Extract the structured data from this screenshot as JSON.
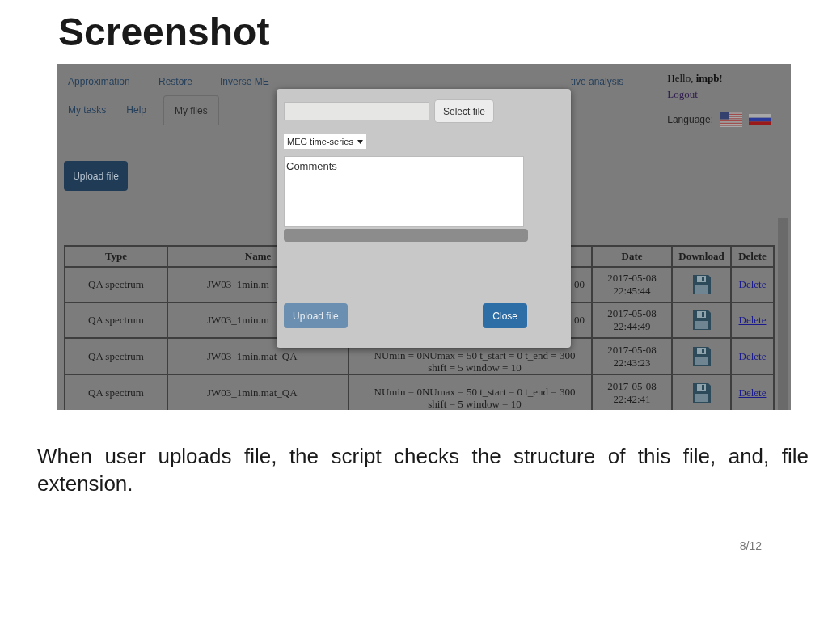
{
  "slide": {
    "title": "Screenshot",
    "caption": "When user uploads file, the script checks the structure of this file, and, file extension.",
    "page_number": "8/12"
  },
  "screen": {
    "nav_tabs": [
      {
        "label": "Approximation",
        "selected": false
      },
      {
        "label": "Restore",
        "selected": false
      },
      {
        "label": "Inverse ME",
        "selected": false
      },
      {
        "label": "tive analysis",
        "selected": false
      }
    ],
    "sub_tabs": [
      {
        "label": "My tasks",
        "selected": false
      },
      {
        "label": "Help",
        "selected": false
      },
      {
        "label": "My files",
        "selected": true
      }
    ],
    "greeting": "Hello, **impb**!",
    "logout": "Logout",
    "language_label": "Language:",
    "upload_button": "Upload file",
    "table": {
      "columns": {
        "type": "Type",
        "name": "Name",
        "date": "Date",
        "download": "Download",
        "delete": "Delete"
      },
      "rows": [
        {
          "type": "QA spectrum",
          "name": "JW03_1min.m",
          "parameters": "00",
          "date": "2017-05-08",
          "time": "22:45:44",
          "delete": "Delete"
        },
        {
          "type": "QA spectrum",
          "name": "JW03_1min.m",
          "parameters": "00",
          "date": "2017-05-08",
          "time": "22:44:49",
          "delete": "Delete"
        },
        {
          "type": "QA spectrum",
          "name": "JW03_1min.mat_QA",
          "parameters": "NUmin = 0NUmax = 50 t_start = 0 t_end = 300 shift = 5 window = 10",
          "date": "2017-05-08",
          "time": "22:43:23",
          "delete": "Delete"
        },
        {
          "type": "QA spectrum",
          "name": "JW03_1min.mat_QA",
          "parameters": "NUmin = 0NUmax = 50 t_start = 0 t_end = 300 shift = 5 window = 10",
          "date": "2017-05-08",
          "time": "22:42:41",
          "delete": "Delete"
        }
      ]
    },
    "dialog": {
      "select_button": "Select file",
      "type_select": "MEG time-series",
      "comments_placeholder": "Comments",
      "progress": {
        "level": 0
      },
      "upload_button": {
        "label": "Upload file",
        "disabled": true
      },
      "close_button": {
        "label": "Close",
        "disabled": false
      }
    }
  }
}
